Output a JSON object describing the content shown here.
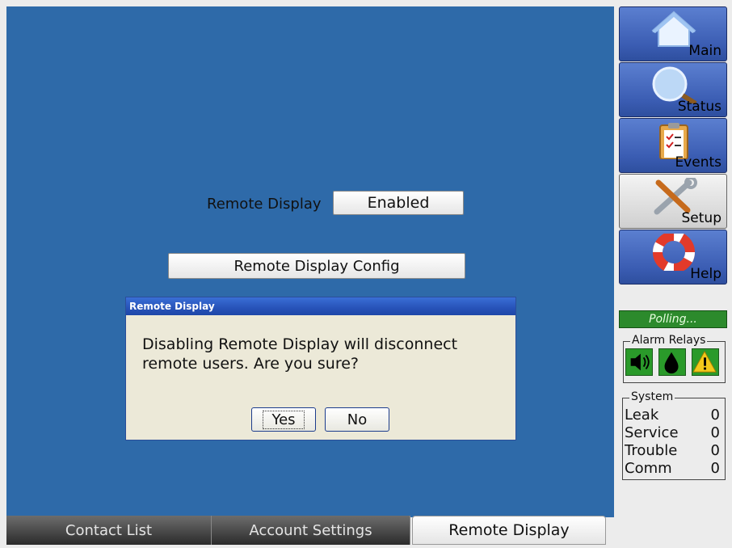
{
  "main": {
    "remote_display_label": "Remote Display",
    "remote_display_value": "Enabled",
    "config_button": "Remote Display Config"
  },
  "dialog": {
    "title": "Remote Display",
    "message_line1": "Disabling Remote Display will disconnect",
    "message_line2": "remote users. Are you sure?",
    "yes": "Yes",
    "no": "No"
  },
  "tabs": [
    {
      "label": "Contact List"
    },
    {
      "label": "Account Settings"
    },
    {
      "label": "Remote Display",
      "active": true
    }
  ],
  "nav": [
    {
      "label": "Main",
      "icon": "house-icon"
    },
    {
      "label": "Status",
      "icon": "magnifier-icon"
    },
    {
      "label": "Events",
      "icon": "clipboard-icon"
    },
    {
      "label": "Setup",
      "icon": "tools-icon",
      "active": true
    },
    {
      "label": "Help",
      "icon": "lifebuoy-icon"
    }
  ],
  "status": {
    "polling": "Polling..."
  },
  "alarm_relays": {
    "title": "Alarm Relays",
    "icons": [
      "speaker-icon",
      "drop-icon",
      "warning-icon"
    ]
  },
  "system": {
    "title": "System",
    "rows": [
      {
        "label": "Leak",
        "value": "0"
      },
      {
        "label": "Service",
        "value": "0"
      },
      {
        "label": "Trouble",
        "value": "0"
      },
      {
        "label": "Comm",
        "value": "0"
      }
    ]
  },
  "colors": {
    "background_blue": "#2e6aa9",
    "nav_blue": "#3b5db3",
    "polling_green": "#2c8a2c",
    "dialog_title": "#2752b8"
  }
}
